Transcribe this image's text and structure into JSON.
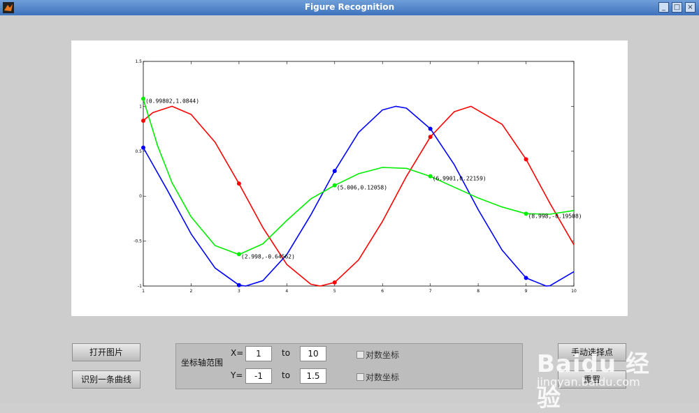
{
  "window": {
    "title": "Figure Recognition",
    "buttons": {
      "minimize": "_",
      "maximize": "□",
      "close": "×"
    }
  },
  "buttons": {
    "open_image": "打开图片",
    "recognize_curve": "识别一条曲线",
    "manual_point": "手动选择点",
    "reset": "重置"
  },
  "axis_panel": {
    "title": "坐标轴范围",
    "x_label": "X=",
    "x_from": "1",
    "to": "to",
    "x_to": "10",
    "y_label": "Y=",
    "y_from": "-1",
    "y_to": "1.5",
    "log_label": "对数坐标"
  },
  "watermark": {
    "line1": "Baidu 经验",
    "line2": "jingyan.baidu.com"
  },
  "chart_data": {
    "type": "line",
    "xlim": [
      1,
      10
    ],
    "ylim": [
      -1,
      1.5
    ],
    "xticks": [
      "1",
      "2",
      "3",
      "4",
      "5",
      "6",
      "7",
      "8",
      "9",
      "10"
    ],
    "yticks": [
      "-1",
      "-0.5",
      "0",
      "0.5",
      "1",
      "1.5"
    ],
    "grid": false,
    "series": [
      {
        "color": "#ff0000",
        "x": [
          1,
          1.2,
          1.6,
          2,
          2.5,
          3,
          3.5,
          4,
          4.5,
          4.7,
          5,
          5.5,
          6,
          6.5,
          7,
          7.5,
          7.85,
          8.5,
          9,
          9.5,
          10
        ],
        "y": [
          0.84,
          0.93,
          1.0,
          0.91,
          0.6,
          0.14,
          -0.35,
          -0.76,
          -0.98,
          -1.0,
          -0.96,
          -0.71,
          -0.28,
          0.22,
          0.66,
          0.94,
          1.0,
          0.8,
          0.41,
          -0.08,
          -0.54
        ],
        "markers_x": [
          1,
          3,
          5,
          7,
          9
        ],
        "markers_y": [
          0.84,
          0.14,
          -0.96,
          0.66,
          0.41
        ]
      },
      {
        "color": "#0000ff",
        "x": [
          1,
          1.5,
          2,
          2.5,
          3,
          3.14,
          3.5,
          4,
          4.5,
          5,
          5.5,
          6,
          6.28,
          6.5,
          7,
          7.5,
          8,
          8.5,
          9,
          9.42,
          9.5,
          10
        ],
        "y": [
          0.54,
          0.07,
          -0.42,
          -0.8,
          -0.99,
          -1.0,
          -0.94,
          -0.65,
          -0.21,
          0.28,
          0.71,
          0.96,
          1.0,
          0.98,
          0.75,
          0.35,
          -0.15,
          -0.6,
          -0.91,
          -1.0,
          -0.997,
          -0.84
        ],
        "markers_x": [
          1,
          3,
          5,
          7,
          9
        ],
        "markers_y": [
          0.54,
          -0.99,
          0.28,
          0.75,
          -0.91
        ]
      },
      {
        "color": "#00ee00",
        "x": [
          1,
          1.3,
          1.6,
          2,
          2.5,
          3,
          3.5,
          4,
          4.5,
          5,
          5.5,
          6,
          6.5,
          7,
          7.5,
          8,
          8.5,
          9,
          9.5,
          10
        ],
        "y": [
          1.08,
          0.56,
          0.15,
          -0.23,
          -0.55,
          -0.65,
          -0.53,
          -0.27,
          -0.03,
          0.12,
          0.25,
          0.32,
          0.31,
          0.22,
          0.1,
          -0.02,
          -0.12,
          -0.195,
          -0.2,
          -0.16
        ],
        "markers_x": [
          1,
          3,
          5,
          7,
          9
        ],
        "markers_y": [
          1.0844,
          -0.64562,
          0.12058,
          0.22159,
          -0.19508
        ]
      }
    ],
    "annotations": [
      "(0.99802,1.0844)",
      "(2.998,-0.64562)",
      "(5.006,0.12058)",
      "(6.9901,0.22159)",
      "(8.998,-0.19508)"
    ]
  }
}
